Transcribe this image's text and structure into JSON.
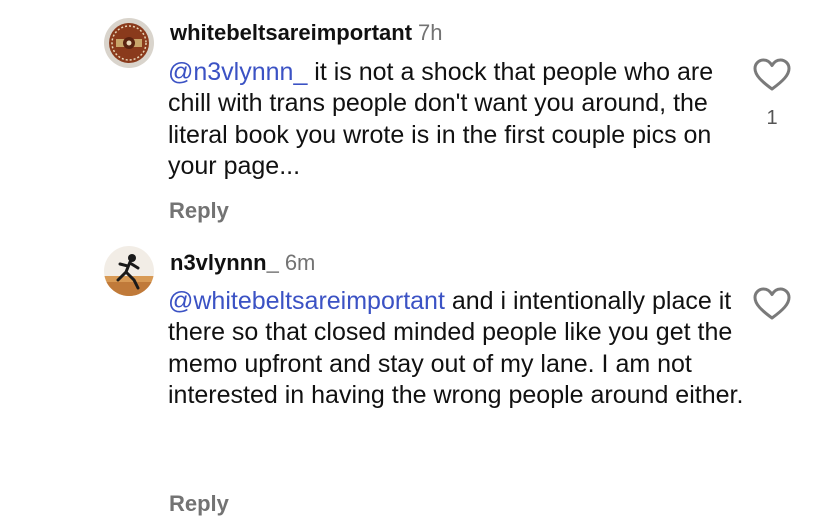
{
  "comments": [
    {
      "username": "whitebeltsareimportant",
      "time": "7h",
      "mention": "@n3vlynnn_",
      "text": " it is not a shock that people who are chill with trans people don't want you around, the literal book you wrote is in the first couple pics on your page...",
      "reply_label": "Reply",
      "like_count": "1",
      "avatar_icon": "coin-seal-avatar"
    },
    {
      "username": "n3vlynnn_",
      "time": "6m",
      "mention": "@whitebeltsareimportant",
      "text": " and i intentionally place it there so that closed minded people like you get the memo upfront and stay out of my lane. I am not interested in having the wrong people around either.",
      "reply_label": "Reply",
      "avatar_icon": "person-photo-avatar"
    }
  ],
  "colors": {
    "mention": "#3b52c4",
    "secondary_text": "#737373"
  }
}
